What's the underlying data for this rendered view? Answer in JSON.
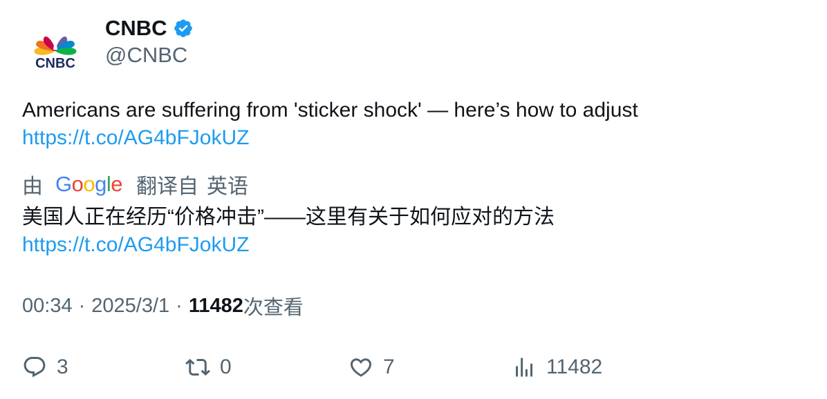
{
  "author": {
    "display_name": "CNBC",
    "handle": "@CNBC",
    "verified": true,
    "logo_text": "CNBC"
  },
  "tweet": {
    "text": "Americans are suffering from 'sticker shock' — here’s how to adjust",
    "link": "https://t.co/AG4bFJokUZ"
  },
  "translation": {
    "by_label": "由",
    "provider": "Google",
    "from_label": "翻译自",
    "language": "英语",
    "text": "美国人正在经历“价格冲击”——这里有关于如何应对的方法",
    "link": "https://t.co/AG4bFJokUZ"
  },
  "meta": {
    "time": "00:34",
    "separator": "·",
    "date": "2025/3/1",
    "views_count": "11482",
    "views_label": "次查看"
  },
  "actions": {
    "replies": "3",
    "retweets": "0",
    "likes": "7",
    "views": "11482"
  },
  "colors": {
    "link": "#1d9bf0",
    "verified_badge": "#1d9bf0",
    "muted_text": "#536471",
    "primary_text": "#0f1419"
  }
}
